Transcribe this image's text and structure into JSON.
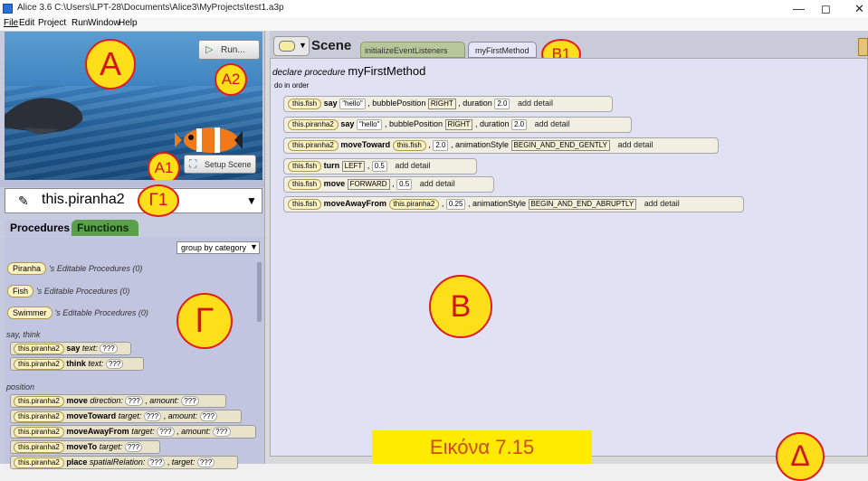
{
  "window": {
    "title": "Alice 3.6 C:\\Users\\LPT-28\\Documents\\Alice3\\MyProjects\\test1.a3p",
    "minimize": "—",
    "maximize": "◻",
    "close": "✕"
  },
  "menu": [
    "File",
    "Edit",
    "Project",
    "Run",
    "Window",
    "Help"
  ],
  "scene_view": {
    "run_label": "Run...",
    "setup_label": "Setup Scene",
    "labels": {
      "A": "A",
      "A1": "A1",
      "A2": "A2"
    }
  },
  "selector": {
    "value": "this.piranha2",
    "label": "Γ1"
  },
  "left_tabs": {
    "procedures": "Procedures",
    "functions": "Functions"
  },
  "group_by": "group by category",
  "editable": [
    {
      "class": "Piranha",
      "text": "'s Editable Procedures (0)"
    },
    {
      "class": "Fish",
      "text": "'s Editable Procedures (0)"
    },
    {
      "class": "Swimmer",
      "text": "'s Editable Procedures (0)"
    }
  ],
  "gamma_label": "Γ",
  "sections": {
    "say_think": "say, think",
    "position": "position"
  },
  "obj_name": "this.piranha2",
  "unknown": "???",
  "say_think_tiles": [
    {
      "method": "say",
      "param": "text:"
    },
    {
      "method": "think",
      "param": "text:"
    }
  ],
  "position_tiles": [
    {
      "method": "move",
      "param": "direction:",
      "param2": "amount:"
    },
    {
      "method": "moveToward",
      "param": "target:",
      "param2": "amount:"
    },
    {
      "method": "moveAwayFrom",
      "param": "target:",
      "param2": "amount:"
    },
    {
      "method": "moveTo",
      "param": "target:"
    },
    {
      "method": "place",
      "param": "spatialRelation:",
      "param2": "target:"
    }
  ],
  "scene_tab": "Scene",
  "tabs": {
    "init": "initializeEventListeners",
    "method": "myFirstMethod"
  },
  "b1_label": "B1",
  "declare": {
    "prefix": "declare procedure",
    "name": "myFirstMethod"
  },
  "do_in_order": "do in order",
  "add_detail": "add detail",
  "statements": [
    {
      "obj": "this.fish",
      "method": "say",
      "arg": "\"hello\"",
      "pos_label": ", bubblePosition",
      "pos": "RIGHT",
      "dur_label": ", duration",
      "dur": "2.0"
    },
    {
      "obj": "this.piranha2",
      "method": "say",
      "arg": "\"hello\"",
      "pos_label": ", bubblePosition",
      "pos": "RIGHT",
      "dur_label": ", duration",
      "dur": "2.0"
    },
    {
      "obj": "this.piranha2",
      "method": "moveToward",
      "arg": "this.fish",
      "num": "2.0",
      "style_label": ", animationStyle",
      "style": "BEGIN_AND_END_GENTLY"
    },
    {
      "obj": "this.fish",
      "method": "turn",
      "arg": "LEFT",
      "num": "0.5"
    },
    {
      "obj": "this.fish",
      "method": "move",
      "arg": "FORWARD",
      "num": "0.5"
    },
    {
      "obj": "this.fish",
      "method": "moveAwayFrom",
      "arg": "this.piranha2",
      "num": "0.25",
      "style_label": ", animationStyle",
      "style": "BEGIN_AND_END_ABRUPTLY"
    }
  ],
  "b_label": "B",
  "delta_label": "Δ",
  "caption": "Εικόνα 7.15",
  "colors": {
    "badge_fill": "#ffde1a",
    "badge_border": "#e21b1b",
    "badge_text": "#d41414",
    "caption_bg": "#ffeb00",
    "caption_text": "#d14a14"
  }
}
